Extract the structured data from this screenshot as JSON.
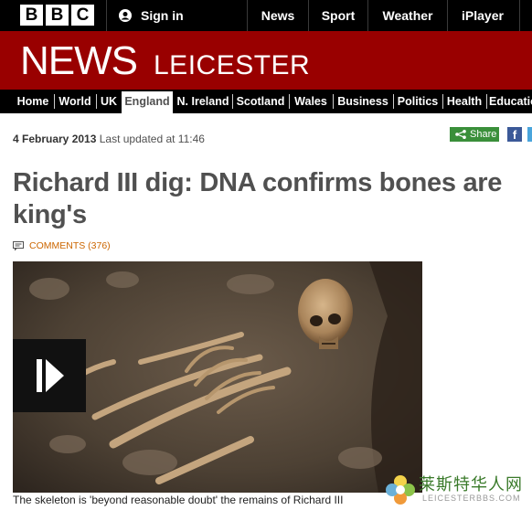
{
  "header": {
    "logo_letters": [
      "B",
      "B",
      "C"
    ],
    "signin_label": "Sign in",
    "nav": [
      "News",
      "Sport",
      "Weather",
      "iPlayer"
    ]
  },
  "banner": {
    "brand": "NEWS",
    "region": "LEICESTER"
  },
  "section_nav": [
    {
      "label": "Home",
      "active": false
    },
    {
      "label": "World",
      "active": false
    },
    {
      "label": "UK",
      "active": false
    },
    {
      "label": "England",
      "active": true
    },
    {
      "label": "N. Ireland",
      "active": false
    },
    {
      "label": "Scotland",
      "active": false
    },
    {
      "label": "Wales",
      "active": false
    },
    {
      "label": "Business",
      "active": false
    },
    {
      "label": "Politics",
      "active": false
    },
    {
      "label": "Health",
      "active": false
    },
    {
      "label": "Educatio",
      "active": false
    }
  ],
  "article": {
    "date": "4 February 2013",
    "updated": "Last updated at 11:46",
    "share_label": "Share",
    "headline": "Richard III dig: DNA confirms bones are king's",
    "comments_label": "COMMENTS (376)",
    "caption": "The skeleton is 'beyond reasonable doubt' the remains of Richard III"
  },
  "watermark": {
    "chinese": "莱斯特华人网",
    "url": "LEICESTERBBS.COM"
  },
  "colors": {
    "banner_red": "#990000",
    "top_bar": "#000000",
    "comments_orange": "#cc6600",
    "share_green": "#3a8f3a",
    "facebook_blue": "#3b5998"
  }
}
